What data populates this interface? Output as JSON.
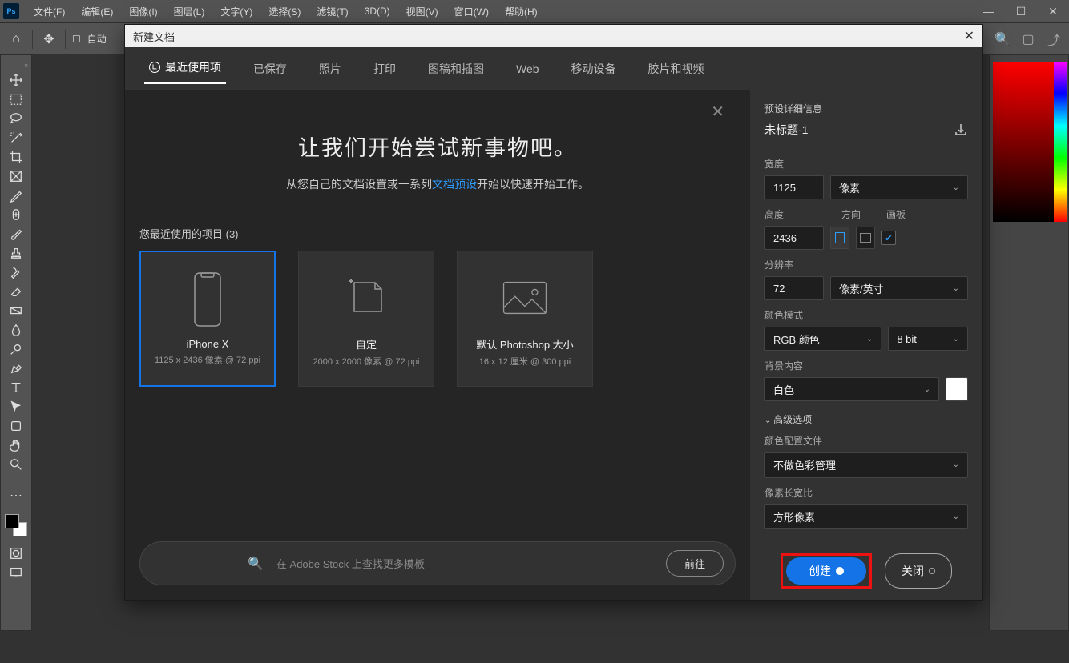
{
  "menu": {
    "items": [
      "文件(F)",
      "编辑(E)",
      "图像(I)",
      "图层(L)",
      "文字(Y)",
      "选择(S)",
      "滤镜(T)",
      "3D(D)",
      "视图(V)",
      "窗口(W)",
      "帮助(H)"
    ]
  },
  "options": {
    "auto": "自动"
  },
  "dialog": {
    "title": "新建文档",
    "tabs": [
      "最近使用项",
      "已保存",
      "照片",
      "打印",
      "图稿和插图",
      "Web",
      "移动设备",
      "胶片和视频"
    ],
    "hero": {
      "title": "让我们开始尝试新事物吧。",
      "prefix": "从您自己的文档设置或一系列",
      "link": "文档预设",
      "suffix": "开始以快速开始工作。"
    },
    "recent_label": "您最近使用的项目 (3)",
    "presets": [
      {
        "name": "iPhone X",
        "meta": "1125 x 2436 像素 @ 72 ppi"
      },
      {
        "name": "自定",
        "meta": "2000 x 2000 像素 @ 72 ppi"
      },
      {
        "name": "默认 Photoshop 大小",
        "meta": "16 x 12 厘米 @ 300 ppi"
      }
    ],
    "search": {
      "placeholder": "在 Adobe Stock 上查找更多模板",
      "go": "前往"
    },
    "details": {
      "header": "预设详细信息",
      "name": "未标题-1",
      "width_label": "宽度",
      "width": "1125",
      "unit": "像素",
      "height_label": "高度",
      "height": "2436",
      "orient_label": "方向",
      "artboard_label": "画板",
      "res_label": "分辨率",
      "res": "72",
      "res_unit": "像素/英寸",
      "mode_label": "颜色模式",
      "mode": "RGB 颜色",
      "depth": "8 bit",
      "bg_label": "背景内容",
      "bg": "白色",
      "adv_label": "高级选项",
      "profile_label": "颜色配置文件",
      "profile": "不做色彩管理",
      "aspect_label": "像素长宽比",
      "aspect": "方形像素",
      "create": "创建",
      "close": "关闭"
    }
  }
}
